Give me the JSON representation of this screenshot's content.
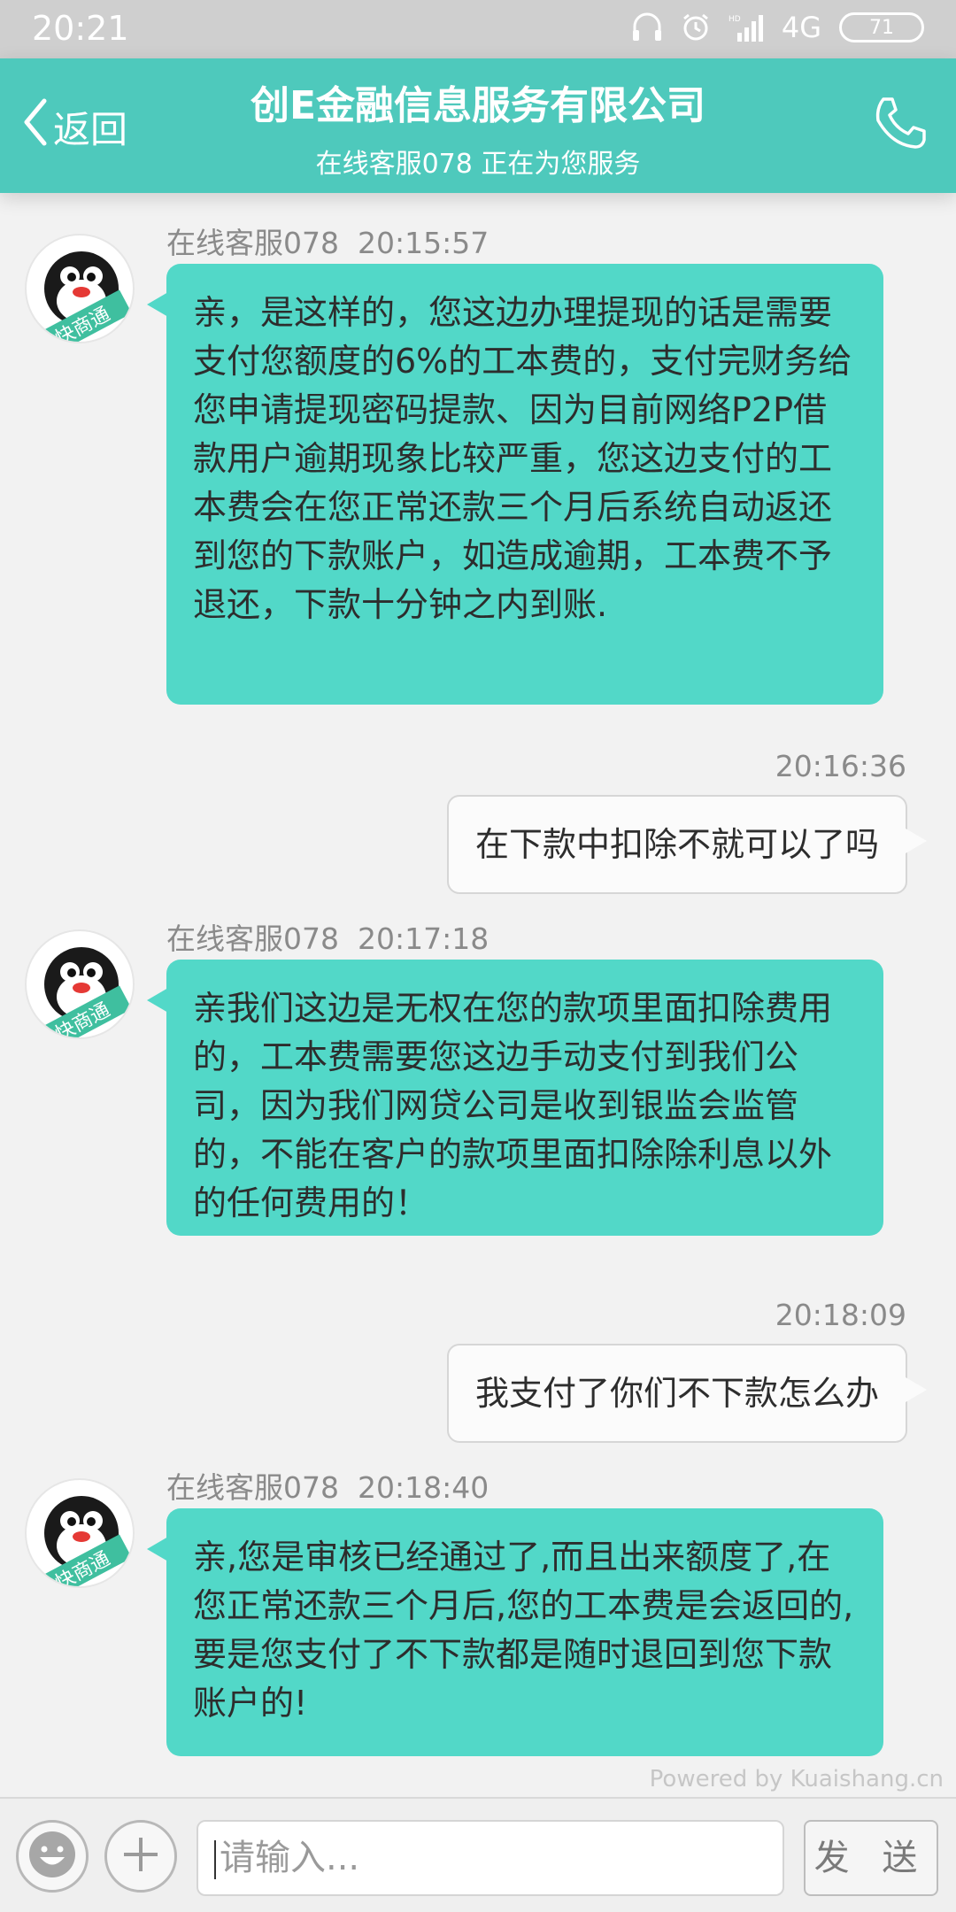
{
  "status": {
    "time": "20:21",
    "network": "4G",
    "hd": "HD",
    "battery": "71"
  },
  "header": {
    "back_label": "返回",
    "title": "创E金融信息服务有限公司",
    "subtitle": "在线客服078 正在为您服务"
  },
  "messages": [
    {
      "sender": "在线客服078",
      "time": "20:15:57",
      "text": "亲，是这样的，您这边办理提现的话是需要支付您额度的6%的工本费的，支付完财务给您申请提现密码提款、因为目前网络P2P借款用户逾期现象比较严重，您这边支付的工本费会在您正常还款三个月后系统自动返还到您的下款账户，如造成逾期，工本费不予退还，下款十分钟之内到账."
    },
    {
      "time": "20:16:36",
      "text": "在下款中扣除不就可以了吗"
    },
    {
      "sender": "在线客服078",
      "time": "20:17:18",
      "text": "亲我们这边是无权在您的款项里面扣除费用的，工本费需要您这边手动支付到我们公司，因为我们网贷公司是收到银监会监管的，不能在客户的款项里面扣除除利息以外的任何费用的！"
    },
    {
      "time": "20:18:09",
      "text": "我支付了你们不下款怎么办"
    },
    {
      "sender": "在线客服078",
      "time": "20:18:40",
      "text": "亲,您是审核已经通过了,而且出来额度了,在您正常还款三个月后,您的工本费是会返回的,要是您支付了不下款都是随时退回到您下款账户的!"
    }
  ],
  "avatar_badge": "快商通",
  "powered_by": "Powered by Kuaishang.cn",
  "input": {
    "placeholder": "请输入..."
  },
  "send_label": "发 送",
  "colors": {
    "accent": "#4ec9bc",
    "incoming_bubble": "#52d8c8",
    "outgoing_bubble": "#fbfbfb"
  }
}
